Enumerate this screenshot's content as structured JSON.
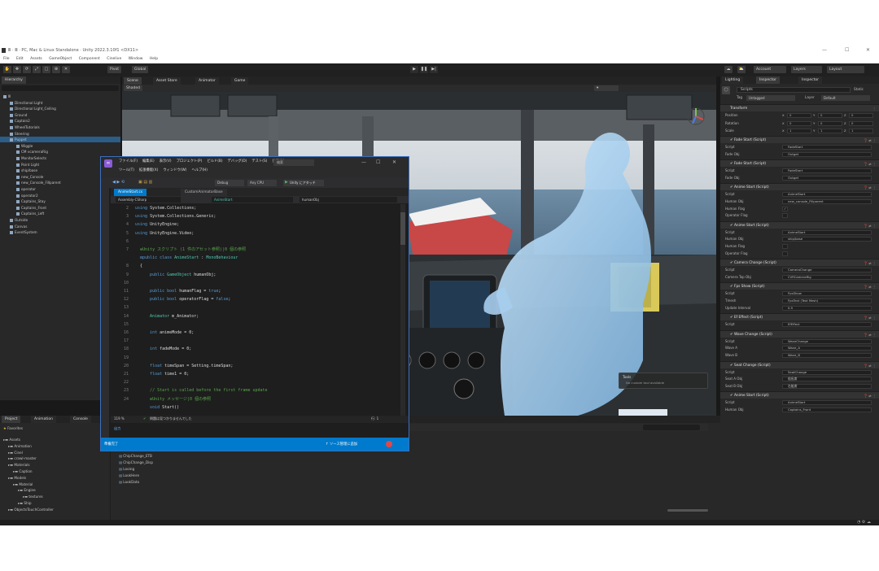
{
  "window": {
    "title": "Ⅲ · Ⅲ · PC, Mac & Linux Standalone · Unity 2022.3.10f1 <DX11>",
    "controls": [
      "—",
      "☐",
      "✕"
    ]
  },
  "menu": [
    "File",
    "Edit",
    "Assets",
    "GameObject",
    "Component",
    "Cinelive",
    "Window",
    "Help"
  ],
  "toolbar": {
    "pivot": "Pivot",
    "global": "Global",
    "account": "Account",
    "layers": "Layers",
    "layout": "Layout"
  },
  "hierarchy": {
    "tab": "Hierarchy",
    "items": [
      {
        "label": "Ⅲ",
        "indent": 0,
        "sel": false
      },
      {
        "label": "Directional Light",
        "indent": 1,
        "sel": false
      },
      {
        "label": "Directional Light_Ceiling",
        "indent": 1,
        "sel": false
      },
      {
        "label": "Ground",
        "indent": 1,
        "sel": false
      },
      {
        "label": "Captain2",
        "indent": 1,
        "sel": false
      },
      {
        "label": "WheelTutorials",
        "indent": 1,
        "sel": false
      },
      {
        "label": "Steering",
        "indent": 1,
        "sel": false
      },
      {
        "label": "Puppet",
        "indent": 1,
        "sel": true
      },
      {
        "label": "Wiggle",
        "indent": 2,
        "sel": false
      },
      {
        "label": "CM vcameraRig",
        "indent": 2,
        "sel": false
      },
      {
        "label": "MonitorSelects",
        "indent": 2,
        "sel": false
      },
      {
        "label": "Point Light",
        "indent": 2,
        "sel": false
      },
      {
        "label": "ship/base",
        "indent": 2,
        "sel": false
      },
      {
        "label": "new_Console",
        "indent": 2,
        "sel": false
      },
      {
        "label": "new_Console_Fillparent",
        "indent": 2,
        "sel": false
      },
      {
        "label": "operator",
        "indent": 2,
        "sel": false
      },
      {
        "label": "operator2",
        "indent": 2,
        "sel": false
      },
      {
        "label": "Captains_Stay",
        "indent": 2,
        "sel": false
      },
      {
        "label": "Captains_Front",
        "indent": 2,
        "sel": false
      },
      {
        "label": "Captains_Left",
        "indent": 2,
        "sel": false
      },
      {
        "label": "Outside",
        "indent": 1,
        "sel": false
      },
      {
        "label": "Canvas",
        "indent": 1,
        "sel": false
      },
      {
        "label": "EventSystem",
        "indent": 1,
        "sel": false
      }
    ]
  },
  "scene_tabs": [
    "Scene",
    "Asset Store",
    "Animator",
    "Game"
  ],
  "scene": {
    "shaded": "Shaded",
    "tools_title": "Tools",
    "tools_body": "No custom tool available"
  },
  "vs": {
    "menu1": [
      "ファイル(F)",
      "編集(E)",
      "表示(V)",
      "プロジェクト(P)",
      "ビルド(B)",
      "デバッグ(D)",
      "テスト(S)",
      "分析(N)"
    ],
    "menu2": [
      "ツール(T)",
      "拡張機能(X)",
      "ウィンドウ(W)",
      "ヘルプ(H)"
    ],
    "search": "検索",
    "debug": "Debug",
    "anycpu": "Any CPU",
    "attach": "Unity にアタッチ",
    "tabs": [
      "AnimeStart.cs",
      "CustomAnimatorBase"
    ],
    "nav_left": "Assembly-CSharp",
    "nav_mid": "AnimeStart",
    "nav_right": "humanObj",
    "lines": [
      {
        "n": "2",
        "c": [
          [
            "kw",
            "using"
          ],
          [
            "tx",
            " System.Collections;"
          ]
        ]
      },
      {
        "n": "3",
        "c": [
          [
            "kw",
            "using"
          ],
          [
            "tx",
            " System.Collections.Generic;"
          ]
        ]
      },
      {
        "n": "4",
        "c": [
          [
            "kw",
            "using"
          ],
          [
            "tx",
            " UnityEngine;"
          ]
        ]
      },
      {
        "n": "5",
        "c": [
          [
            "kw",
            "using"
          ],
          [
            "tx",
            " UnityEngine.Video;"
          ]
        ]
      },
      {
        "n": "6",
        "c": [
          [
            "tx",
            ""
          ]
        ]
      },
      {
        "n": "7",
        "c": [
          [
            "cm",
            "  ⊕Unity スクリプト (1 件のアセット参照)|0 個の参照"
          ]
        ]
      },
      {
        "n": "",
        "c": [
          [
            "kw",
            "  ⊟public class"
          ],
          [
            "tx",
            " "
          ],
          [
            "ty",
            "AnimeStart"
          ],
          [
            "tx",
            " : "
          ],
          [
            "ty",
            "MonoBehaviour"
          ]
        ]
      },
      {
        "n": "8",
        "c": [
          [
            "tx",
            "  {"
          ]
        ]
      },
      {
        "n": "9",
        "c": [
          [
            "kw",
            "      public"
          ],
          [
            "tx",
            " "
          ],
          [
            "ty",
            "GameObject"
          ],
          [
            "tx",
            " humanObj;"
          ]
        ]
      },
      {
        "n": "10",
        "c": [
          [
            "tx",
            ""
          ]
        ]
      },
      {
        "n": "11",
        "c": [
          [
            "kw",
            "      public bool"
          ],
          [
            "tx",
            " humanFlag = "
          ],
          [
            "kw",
            "true"
          ],
          [
            "tx",
            ";"
          ]
        ]
      },
      {
        "n": "12",
        "c": [
          [
            "kw",
            "      public bool"
          ],
          [
            "tx",
            " operatorFlag = "
          ],
          [
            "kw",
            "false"
          ],
          [
            "tx",
            ";"
          ]
        ]
      },
      {
        "n": "13",
        "c": [
          [
            "tx",
            ""
          ]
        ]
      },
      {
        "n": "14",
        "c": [
          [
            "ty",
            "      Animator"
          ],
          [
            "tx",
            " m_Animator;"
          ]
        ]
      },
      {
        "n": "15",
        "c": [
          [
            "tx",
            ""
          ]
        ]
      },
      {
        "n": "16",
        "c": [
          [
            "kw",
            "      int"
          ],
          [
            "tx",
            " animeMode = 0;"
          ]
        ]
      },
      {
        "n": "17",
        "c": [
          [
            "tx",
            ""
          ]
        ]
      },
      {
        "n": "18",
        "c": [
          [
            "kw",
            "      int"
          ],
          [
            "tx",
            " fadeMode = 0;"
          ]
        ]
      },
      {
        "n": "19",
        "c": [
          [
            "tx",
            ""
          ]
        ]
      },
      {
        "n": "20",
        "c": [
          [
            "kw",
            "      float"
          ],
          [
            "tx",
            " timeSpan = Setting.timeSpan;"
          ]
        ]
      },
      {
        "n": "21",
        "c": [
          [
            "kw",
            "      float"
          ],
          [
            "tx",
            " time1 = 0;"
          ]
        ]
      },
      {
        "n": "22",
        "c": [
          [
            "tx",
            ""
          ]
        ]
      },
      {
        "n": "23",
        "c": [
          [
            "cm",
            "      // Start is called before the first frame update"
          ]
        ]
      },
      {
        "n": "24",
        "c": [
          [
            "cm",
            "      ⊕Unity メッセージ|0 個の参照"
          ]
        ]
      },
      {
        "n": "",
        "c": [
          [
            "kw",
            "      void"
          ],
          [
            "tx",
            " Start()"
          ]
        ]
      }
    ],
    "zoom": "119 %",
    "issues": "問題は見つかりませんでした",
    "ln_col": "行: 1",
    "output_label": "出力",
    "status_left": "準備完了",
    "status_right": "↑ ソース管理に追加"
  },
  "inspector": {
    "tabs": [
      "Lighting",
      "Inspector",
      "Inspector"
    ],
    "object_name": "Scripts",
    "tag_label": "Tag",
    "tag_value": "Untagged",
    "layer_label": "Layer",
    "layer_value": "Default",
    "static_label": "Static",
    "transform": {
      "title": "Transform",
      "rows": [
        {
          "label": "Position",
          "x": "0",
          "y": "0",
          "z": "0"
        },
        {
          "label": "Rotation",
          "x": "0",
          "y": "0",
          "z": "0"
        },
        {
          "label": "Scale",
          "x": "1",
          "y": "1",
          "z": "1"
        }
      ]
    },
    "components": [
      {
        "title": "Fade Start (Script)",
        "fields": [
          [
            "Script",
            "FadeStart"
          ],
          [
            "Fade Obj",
            "Outget"
          ]
        ]
      },
      {
        "title": "Fade Start (Script)",
        "fields": [
          [
            "Script",
            "FadeStart"
          ],
          [
            "Fade Obj",
            "Outget"
          ]
        ]
      },
      {
        "title": "Anime Start (Script)",
        "fields": [
          [
            "Script",
            "AnimeStart"
          ],
          [
            "Human Obj",
            "new_console_Fillparent"
          ],
          [
            "Human Flag",
            "✓"
          ],
          [
            "Operator Flag",
            ""
          ]
        ]
      },
      {
        "title": "Anime Start (Script)",
        "fields": [
          [
            "Script",
            "AnimeStart"
          ],
          [
            "Human Obj",
            "ship/base"
          ],
          [
            "Human Flag",
            ""
          ],
          [
            "Operator Flag",
            ""
          ]
        ]
      },
      {
        "title": "Camera Change (Script)",
        "fields": [
          [
            "Script",
            "CameraChange"
          ],
          [
            "Camera Top Obj",
            "CVRCameraRig"
          ]
        ]
      },
      {
        "title": "Fps Show (Script)",
        "fields": [
          [
            "Script",
            "FpsShow"
          ],
          [
            "Tmesh",
            "FpsText (Text Mesh)"
          ],
          [
            "Update Interval",
            "0.5"
          ]
        ]
      },
      {
        "title": "Ef Effect (Script)",
        "fields": [
          [
            "Script",
            "EfEffect"
          ]
        ]
      },
      {
        "title": "Wave Change (Script)",
        "fields": [
          [
            "Script",
            "WaveChange"
          ],
          [
            "Wave A",
            "Wave_A"
          ],
          [
            "Wave B",
            "Wave_B"
          ]
        ]
      },
      {
        "title": "Seat Change (Script)",
        "fields": [
          [
            "Script",
            "SeatChange"
          ],
          [
            "Seat A Obj",
            "船長席"
          ],
          [
            "Seat B Obj",
            "右舷席"
          ]
        ]
      },
      {
        "title": "Anime Start (Script)",
        "fields": [
          [
            "Script",
            "AnimeStart"
          ],
          [
            "Human Obj",
            "Captains_Front"
          ]
        ]
      }
    ]
  },
  "project": {
    "tabs": [
      "Project",
      "Animation",
      "Console"
    ],
    "favorites": "Favorites",
    "tree": [
      "Assets",
      "Animation",
      "Cinel",
      "crawl-master",
      "Materials",
      "Caption",
      "Models",
      "Material",
      "Engine",
      "textures",
      "Ship",
      "ObjectsTouchController"
    ],
    "files": [
      "CaptionItem",
      "CameraSwitcher",
      "ChipChange",
      "ChipChange_ETB",
      "ChipChange_Disp",
      "Looing",
      "LookHere",
      "LookData"
    ]
  }
}
